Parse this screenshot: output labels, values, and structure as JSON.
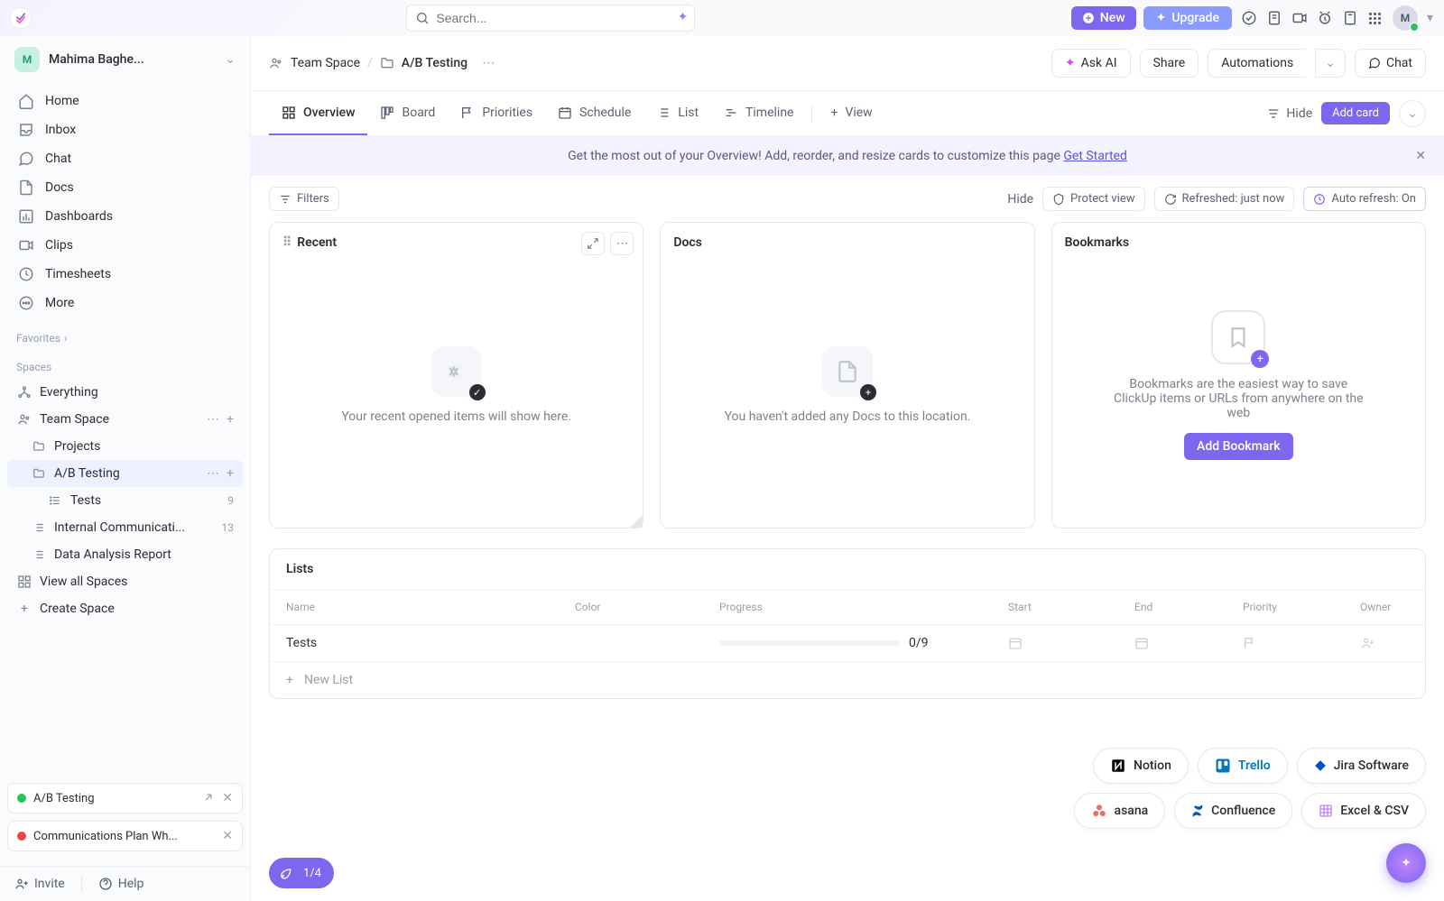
{
  "workspace": {
    "initial": "M",
    "name": "Mahima Baghe..."
  },
  "search": {
    "placeholder": "Search..."
  },
  "topbar": {
    "new": "New",
    "upgrade": "Upgrade"
  },
  "avatar": "M",
  "nav": {
    "home": "Home",
    "inbox": "Inbox",
    "chat": "Chat",
    "docs": "Docs",
    "dashboards": "Dashboards",
    "clips": "Clips",
    "timesheets": "Timesheets",
    "more": "More"
  },
  "favorites_label": "Favorites",
  "spaces_label": "Spaces",
  "tree": {
    "everything": "Everything",
    "team_space": "Team Space",
    "projects": "Projects",
    "ab_testing": "A/B Testing",
    "tests": "Tests",
    "tests_count": "9",
    "internal_comm": "Internal Communicati...",
    "internal_count": "13",
    "data_analysis": "Data Analysis Report",
    "view_all": "View all Spaces",
    "create_space": "Create Space"
  },
  "pinned": [
    {
      "status": "done",
      "title": "A/B Testing"
    },
    {
      "status": "blocked",
      "title": "Communications Plan Wh..."
    }
  ],
  "footer": {
    "invite": "Invite",
    "help": "Help"
  },
  "breadcrumb": {
    "space": "Team Space",
    "folder": "A/B Testing"
  },
  "header_buttons": {
    "ask_ai": "Ask AI",
    "share": "Share",
    "automations": "Automations",
    "chat": "Chat"
  },
  "tabs": {
    "overview": "Overview",
    "board": "Board",
    "priorities": "Priorities",
    "schedule": "Schedule",
    "list": "List",
    "timeline": "Timeline",
    "view": "View",
    "hide": "Hide",
    "add_card": "Add card"
  },
  "banner": {
    "text": "Get the most out of your Overview! Add, reorder, and resize cards to customize this page ",
    "link": "Get Started"
  },
  "toolbar": {
    "filters": "Filters",
    "hide": "Hide",
    "protect": "Protect view",
    "refreshed": "Refreshed: just now",
    "auto": "Auto refresh: On"
  },
  "cards": {
    "recent": {
      "title": "Recent",
      "empty": "Your recent opened items will show here."
    },
    "docs": {
      "title": "Docs",
      "empty": "You haven't added any Docs to this location."
    },
    "bookmarks": {
      "title": "Bookmarks",
      "empty": "Bookmarks are the easiest way to save ClickUp items or URLs from anywhere on the web",
      "button": "Add Bookmark"
    }
  },
  "lists": {
    "title": "Lists",
    "columns": {
      "name": "Name",
      "color": "Color",
      "progress": "Progress",
      "start": "Start",
      "end": "End",
      "priority": "Priority",
      "owner": "Owner"
    },
    "rows": [
      {
        "name": "Tests",
        "progress": "0/9"
      }
    ],
    "new_list": "New List"
  },
  "imports": [
    "Notion",
    "Trello",
    "Jira Software",
    "asana",
    "Confluence",
    "Excel & CSV"
  ],
  "onboard": "1/4"
}
